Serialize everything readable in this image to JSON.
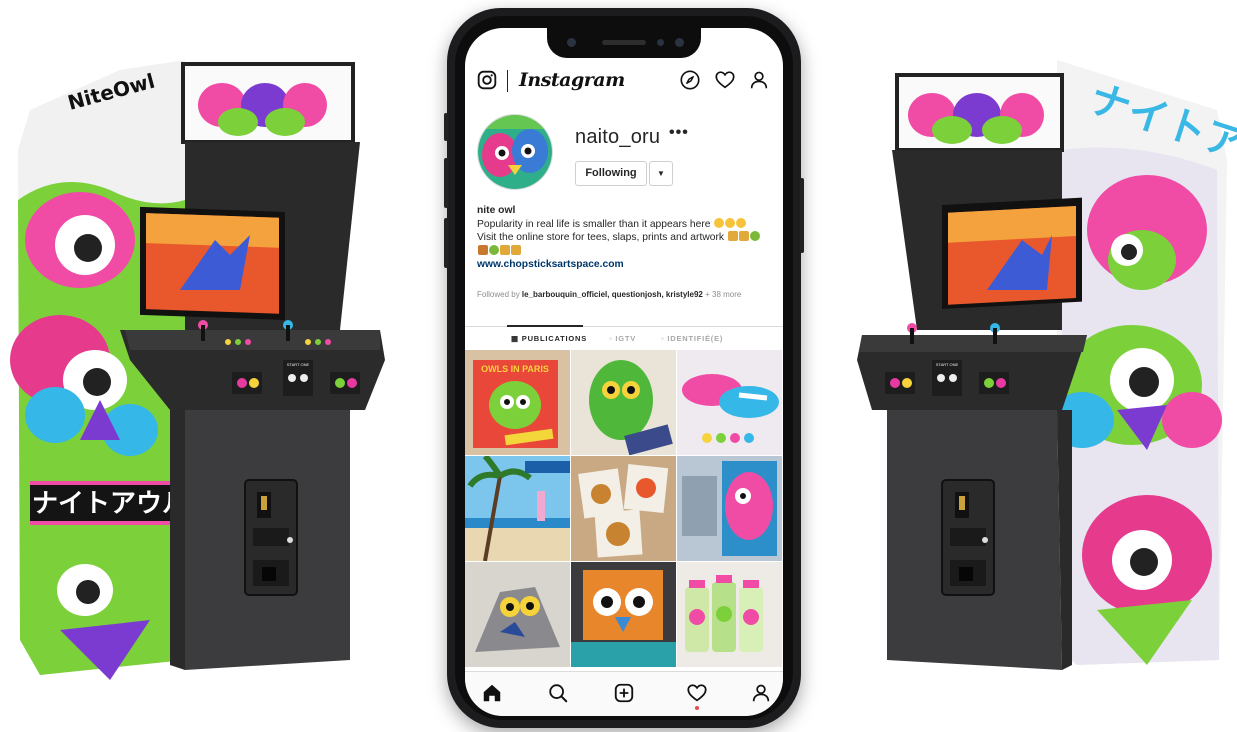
{
  "cabinets": {
    "left": {
      "marquee_tag": "NiteOwl",
      "side_label": "ナイトアウル",
      "start_label": "START ONE"
    },
    "right": {
      "side_label": "ナイトアウル",
      "start_label": "START ONE"
    }
  },
  "instagram": {
    "wordmark": "Instagram",
    "header_icons": [
      "camera-icon",
      "compass-icon",
      "heart-icon",
      "user-icon"
    ],
    "profile": {
      "username": "naito_oru",
      "more": "•••",
      "follow_button": "Following",
      "dropdown": "▼",
      "bio_name": "nite owl",
      "bio_line1": "Popularity in real life is smaller than it appears here",
      "bio_line2": "Visit the online store for tees, slaps, prints and artwork",
      "website": "www.chopsticksartspace.com",
      "followed_prefix": "Followed by",
      "followed_names": "le_barbouquin_officiel, questionjosh, kristyle92",
      "followed_more": "+ 38 more"
    },
    "tabs": [
      {
        "label": "PUBLICATIONS",
        "active": true
      },
      {
        "label": "IGTV",
        "active": false
      },
      {
        "label": "IDENTIFIÉ(E)",
        "active": false
      }
    ],
    "posts": [
      {
        "name": "post-owls-in-paris",
        "caption": "OWLS IN PARIS"
      },
      {
        "name": "post-green-owl-figure"
      },
      {
        "name": "post-painted-sneakers"
      },
      {
        "name": "post-palm-beach"
      },
      {
        "name": "post-sticker-pack"
      },
      {
        "name": "post-pink-wall-mural"
      },
      {
        "name": "post-owl-sculpture"
      },
      {
        "name": "post-orange-owl-mural"
      },
      {
        "name": "post-spray-cans"
      }
    ],
    "bottom_nav": [
      "home-icon",
      "search-icon",
      "new-post-icon",
      "activity-icon",
      "profile-icon"
    ],
    "colors": {
      "link": "#00376b",
      "text": "#262626",
      "muted": "#8e8e8e",
      "notification": "#ed4956"
    }
  }
}
